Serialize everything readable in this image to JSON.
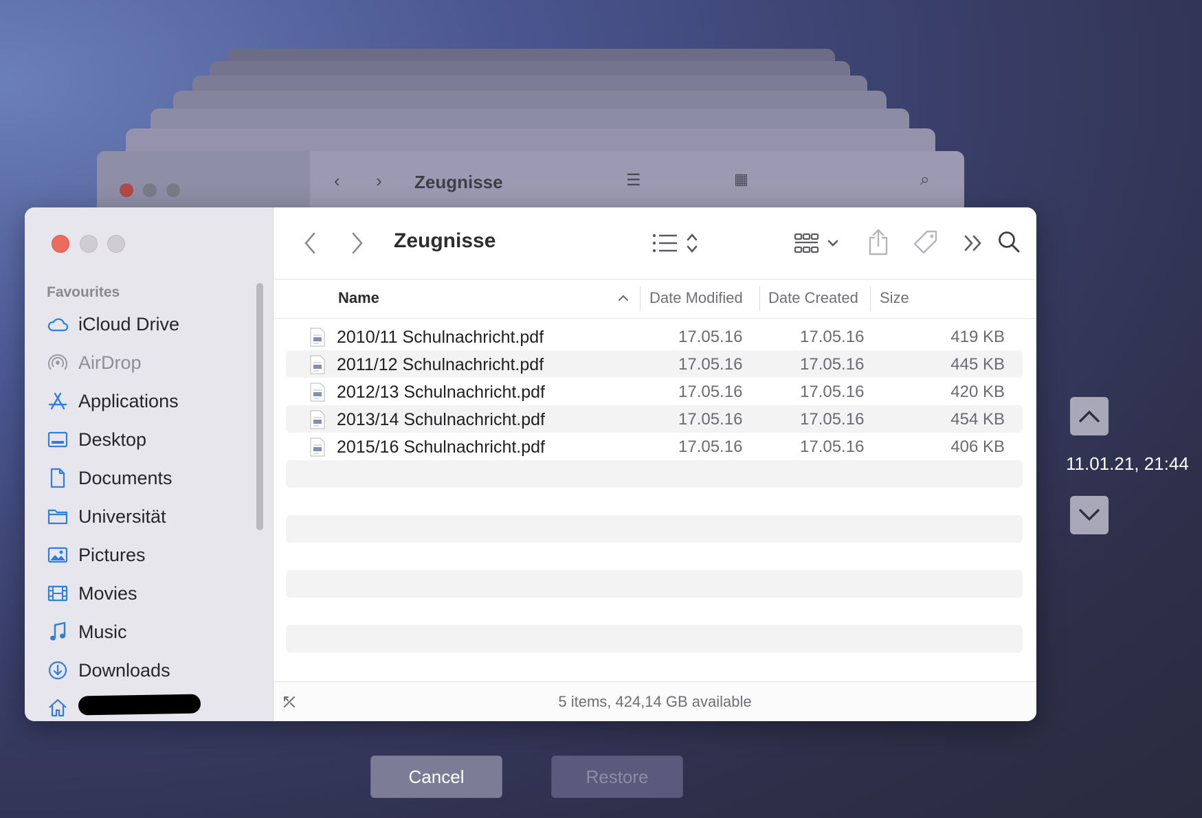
{
  "background_window": {
    "title": "Zeugnisse"
  },
  "window": {
    "title": "Zeugnisse",
    "sidebar": {
      "section": "Favourites",
      "items": [
        {
          "label": "iCloud Drive",
          "icon": "cloud-icon"
        },
        {
          "label": "AirDrop",
          "icon": "airdrop-icon"
        },
        {
          "label": "Applications",
          "icon": "applications-icon"
        },
        {
          "label": "Desktop",
          "icon": "desktop-icon"
        },
        {
          "label": "Documents",
          "icon": "document-icon"
        },
        {
          "label": "Universität",
          "icon": "folder-icon"
        },
        {
          "label": "Pictures",
          "icon": "pictures-icon"
        },
        {
          "label": "Movies",
          "icon": "movies-icon"
        },
        {
          "label": "Music",
          "icon": "music-icon"
        },
        {
          "label": "Downloads",
          "icon": "downloads-icon"
        },
        {
          "label": "",
          "icon": "home-icon"
        }
      ]
    },
    "columns": {
      "name": "Name",
      "date_modified": "Date Modified",
      "date_created": "Date Created",
      "size": "Size"
    },
    "files": [
      {
        "name": "2010/11 Schulnachricht.pdf",
        "modified": "17.05.16",
        "created": "17.05.16",
        "size": "419 KB"
      },
      {
        "name": "2011/12 Schulnachricht.pdf",
        "modified": "17.05.16",
        "created": "17.05.16",
        "size": "445 KB"
      },
      {
        "name": "2012/13 Schulnachricht.pdf",
        "modified": "17.05.16",
        "created": "17.05.16",
        "size": "420 KB"
      },
      {
        "name": "2013/14 Schulnachricht.pdf",
        "modified": "17.05.16",
        "created": "17.05.16",
        "size": "454 KB"
      },
      {
        "name": "2015/16 Schulnachricht.pdf",
        "modified": "17.05.16",
        "created": "17.05.16",
        "size": "406 KB"
      }
    ],
    "status": "5 items, 424,14 GB available"
  },
  "time_machine": {
    "timestamp": "11.01.21, 21:44",
    "cancel_label": "Cancel",
    "restore_label": "Restore"
  },
  "colors": {
    "close_red": "#ec6a5e",
    "accent_blue": "#2f7de1"
  }
}
